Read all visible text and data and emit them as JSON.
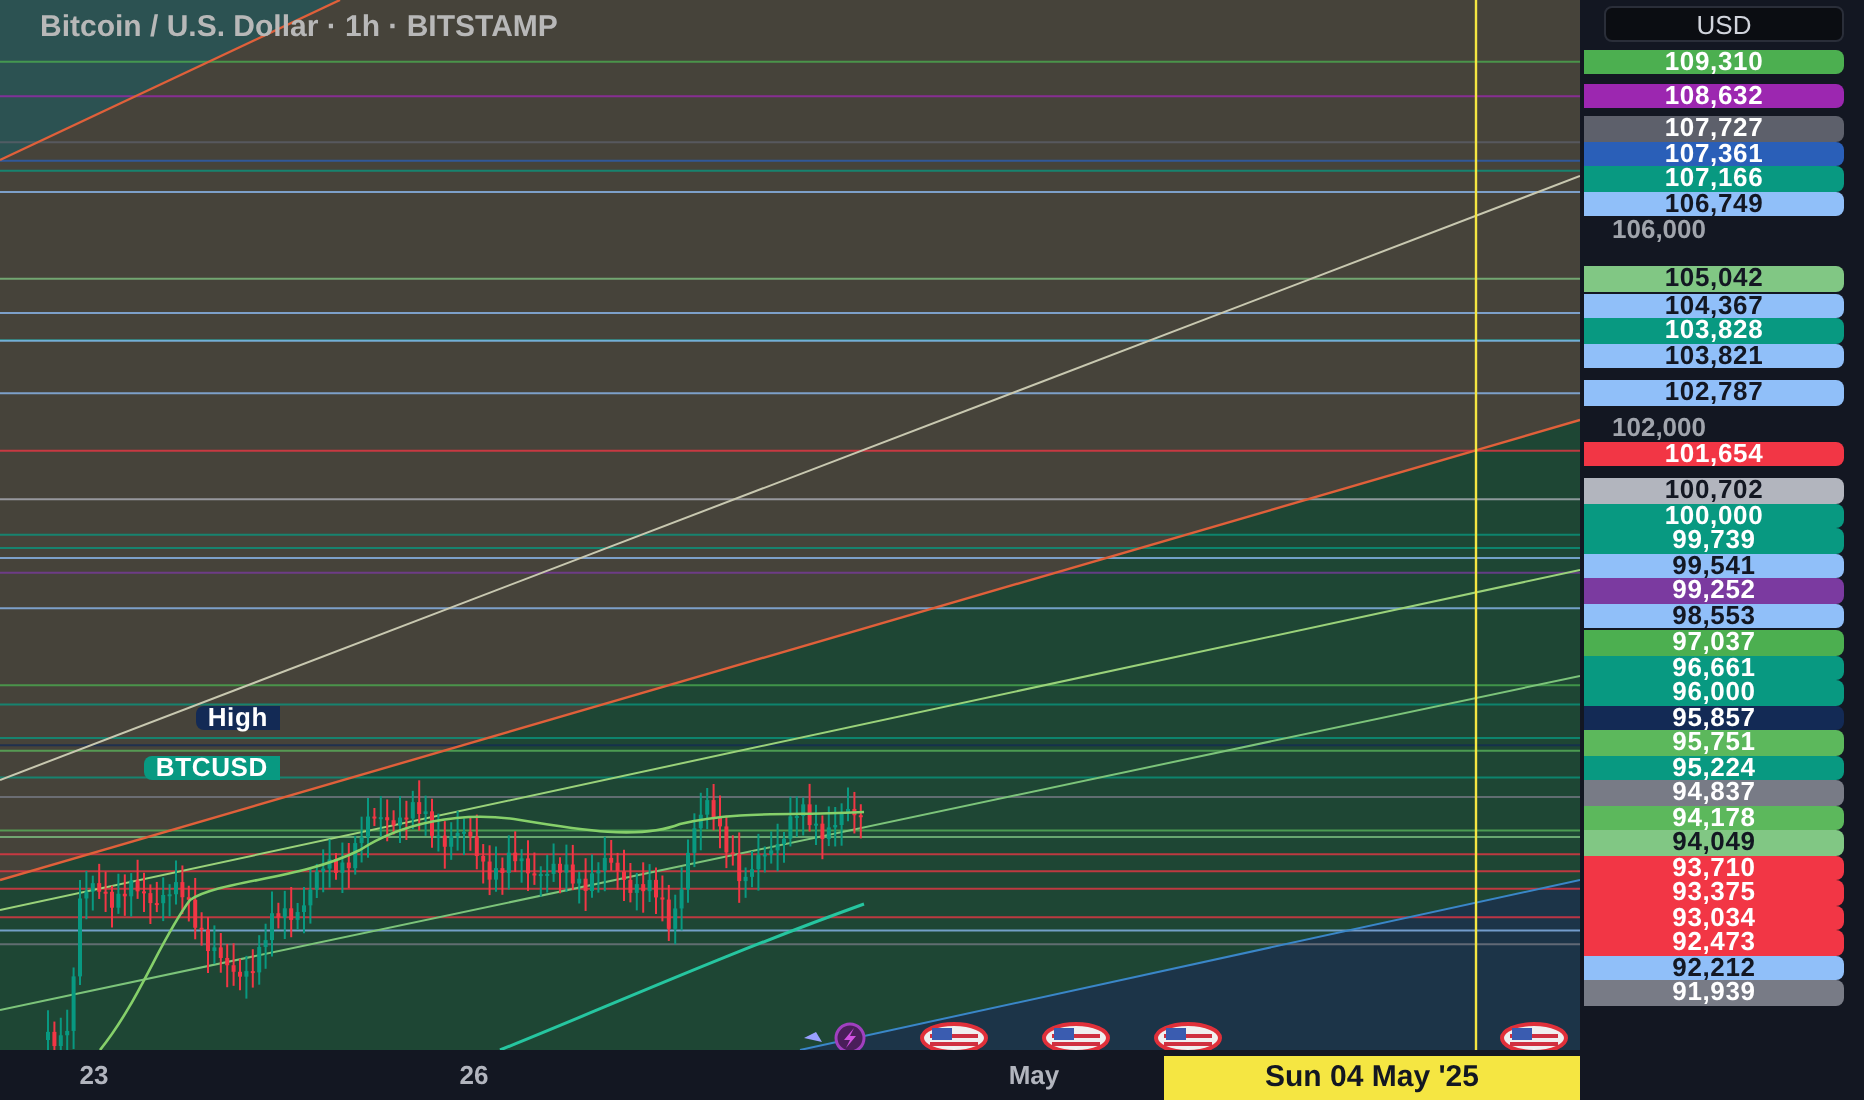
{
  "title": "Bitcoin / U.S. Dollar · 1h · BITSTAMP",
  "currency_button": "USD",
  "price_axis": {
    "ticks": [
      "106,000",
      "102,000"
    ],
    "labels": [
      {
        "value": "109,310",
        "color": "#4caf50"
      },
      {
        "value": "108,632",
        "color": "#9c27b0"
      },
      {
        "value": "107,727",
        "color": "#5d606b"
      },
      {
        "value": "107,361",
        "color": "#2a5fb8"
      },
      {
        "value": "107,166",
        "color": "#089981"
      },
      {
        "value": "106,749",
        "color": "#90bff9"
      },
      {
        "value": "105,042",
        "color": "#81c784"
      },
      {
        "value": "104,367",
        "color": "#90bff9"
      },
      {
        "value": "103,828",
        "color": "#089981"
      },
      {
        "value": "103,821",
        "color": "#90bff9"
      },
      {
        "value": "102,787",
        "color": "#90bff9"
      },
      {
        "value": "101,654",
        "color": "#f23645"
      },
      {
        "value": "100,702",
        "color": "#b2b5be"
      },
      {
        "value": "100,000",
        "color": "#089981"
      },
      {
        "value": "99,739",
        "color": "#089981"
      },
      {
        "value": "99,541",
        "color": "#90bff9"
      },
      {
        "value": "99,252",
        "color": "#7b3aa0"
      },
      {
        "value": "98,553",
        "color": "#90bff9"
      },
      {
        "value": "97,037",
        "color": "#4caf50"
      },
      {
        "value": "96,661",
        "color": "#089981"
      },
      {
        "value": "96,000",
        "color": "#089981"
      },
      {
        "value": "95,857",
        "color": "#132a55",
        "tag": "High"
      },
      {
        "value": "95,751",
        "color": "#5cb85c"
      },
      {
        "value": "95,224",
        "color": "#089981",
        "tag": "BTCUSD"
      },
      {
        "value": "94,837",
        "color": "#787b86"
      },
      {
        "value": "94,178",
        "color": "#5cb85c"
      },
      {
        "value": "94,049",
        "color": "#81c784"
      },
      {
        "value": "93,710",
        "color": "#f23645"
      },
      {
        "value": "93,375",
        "color": "#f23645"
      },
      {
        "value": "93,034",
        "color": "#f23645"
      },
      {
        "value": "92,473",
        "color": "#f23645"
      },
      {
        "value": "92,212",
        "color": "#90bff9"
      },
      {
        "value": "91,939",
        "color": "#787b86"
      }
    ]
  },
  "time_axis": {
    "labels": [
      "23",
      "26",
      "May"
    ],
    "crosshair_label": "Sun 04 May '25"
  },
  "events": [
    {
      "kind": "lightning"
    },
    {
      "kind": "flag"
    },
    {
      "kind": "flag"
    },
    {
      "kind": "flag"
    },
    {
      "kind": "flag"
    }
  ]
}
